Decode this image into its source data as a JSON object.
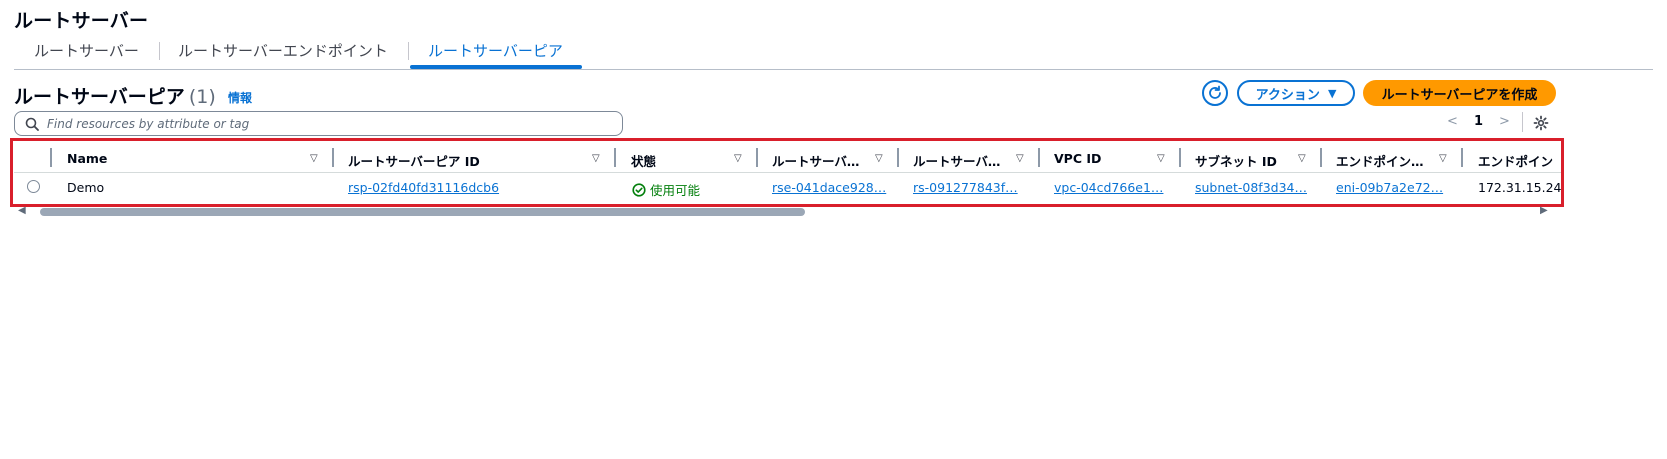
{
  "page": {
    "title": "ルートサーバー"
  },
  "tabs": [
    {
      "label": "ルートサーバー"
    },
    {
      "label": "ルートサーバーエンドポイント"
    },
    {
      "label": "ルートサーバーピア"
    }
  ],
  "section": {
    "title": "ルートサーバーピア",
    "count": "(1)",
    "info_label": "情報"
  },
  "toolbar": {
    "action_label": "アクション",
    "create_label": "ルートサーバーピアを作成"
  },
  "search": {
    "placeholder": "Find resources by attribute or tag"
  },
  "pagination": {
    "current_page": "1",
    "prev": "<",
    "next": ">"
  },
  "table": {
    "columns": [
      "Name",
      "ルートサーバーピア ID",
      "状態",
      "ルートサーバ…",
      "ルートサーバ…",
      "VPC ID",
      "サブネット ID",
      "エンドポイン…",
      "エンドポイン"
    ],
    "rows": [
      {
        "name": "Demo",
        "peer_id": "rsp-02fd40fd31116dcb6",
        "status": "使用可能",
        "endpoint_id": "rse-041dace928…",
        "server_id": "rs-091277843f…",
        "vpc_id": "vpc-04cd766e1…",
        "subnet_id": "subnet-08f3d34…",
        "eni_id": "eni-09b7a2e72…",
        "endpoint_ip": "172.31.15.24"
      }
    ]
  },
  "colors": {
    "accent": "#0972d3",
    "primary_button": "#ff9900",
    "highlight": "#d91f2b",
    "status_ok": "#037f0c"
  }
}
